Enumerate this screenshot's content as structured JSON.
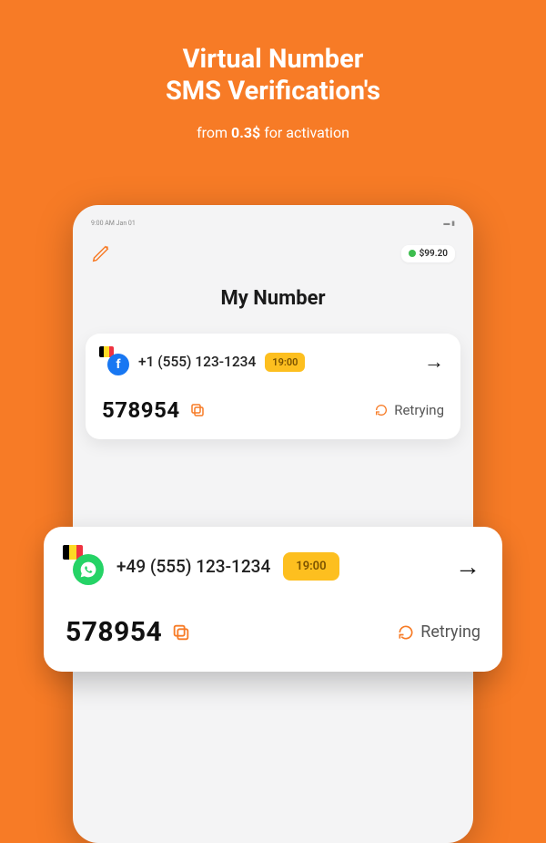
{
  "headline_l1": "Virtual Number",
  "headline_l2": "SMS Verification's",
  "subline_pre": "from ",
  "subline_bold": "0.3$",
  "subline_post": " for activation",
  "status_left": "9:00 AM Jan 01",
  "balance": "$99.20",
  "page_title": "My Number",
  "cards": [
    {
      "app": "facebook",
      "app_color": "#1877F2",
      "app_glyph": "f",
      "phone": "+1 (555) 123-1234",
      "timer": "19:00",
      "code": "578954",
      "retry": "Retrying"
    },
    {
      "app": "whatsapp",
      "app_color": "#25D366",
      "app_glyph": "✆",
      "phone": "+49 (555) 123-1234",
      "timer": "19:00",
      "code": "578954",
      "retry": "Retrying"
    },
    {
      "app": "facebook",
      "app_color": "#1877F2",
      "app_glyph": "f",
      "phone": "+1 (555) 123-1234",
      "timer": "19:00",
      "code": "578954",
      "retry": "Retrying"
    }
  ]
}
